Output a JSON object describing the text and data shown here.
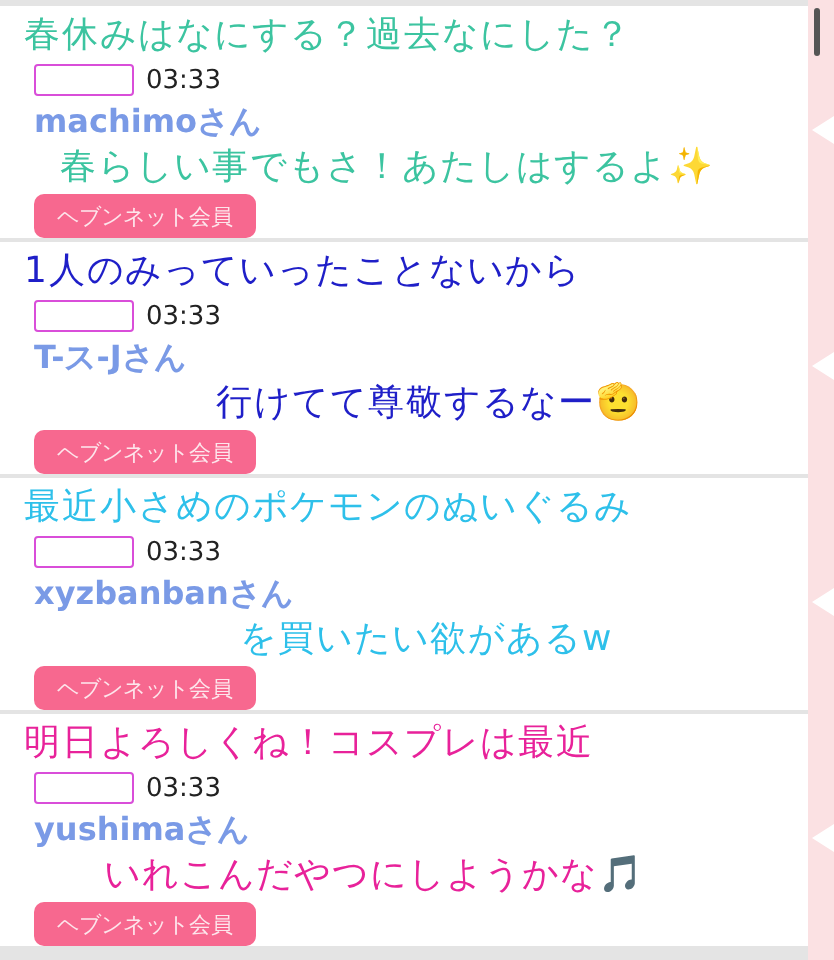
{
  "posts": [
    {
      "time": "03:33",
      "name": "machimoさん",
      "badge": "ヘブンネット会員",
      "caption": {
        "color": "#3cc4a0",
        "lines": [
          "春休みはなにする？過去なにした？",
          "春らしい事でもさ！あたしはするよ✨"
        ]
      }
    },
    {
      "time": "03:33",
      "name": "T-ス-Jさん",
      "badge": "ヘブンネット会員",
      "caption": {
        "color": "#1f1fc8",
        "lines": [
          "1人のみっていったことないから",
          "行けてて尊敬するなー🫡"
        ]
      }
    },
    {
      "time": "03:33",
      "name": "xyzbanbanさん",
      "badge": "ヘブンネット会員",
      "caption": {
        "color": "#2ec0ea",
        "lines": [
          "最近小さめのポケモンのぬいぐるみ",
          "を買いたい欲があるw"
        ]
      }
    },
    {
      "time": "03:33",
      "name": "yushimaさん",
      "badge": "ヘブンネット会員",
      "caption": {
        "color": "#e8229a",
        "lines": [
          "明日よろしくね！コスプレは最近",
          "いれこんだやつにしようかな🎵"
        ]
      }
    }
  ]
}
